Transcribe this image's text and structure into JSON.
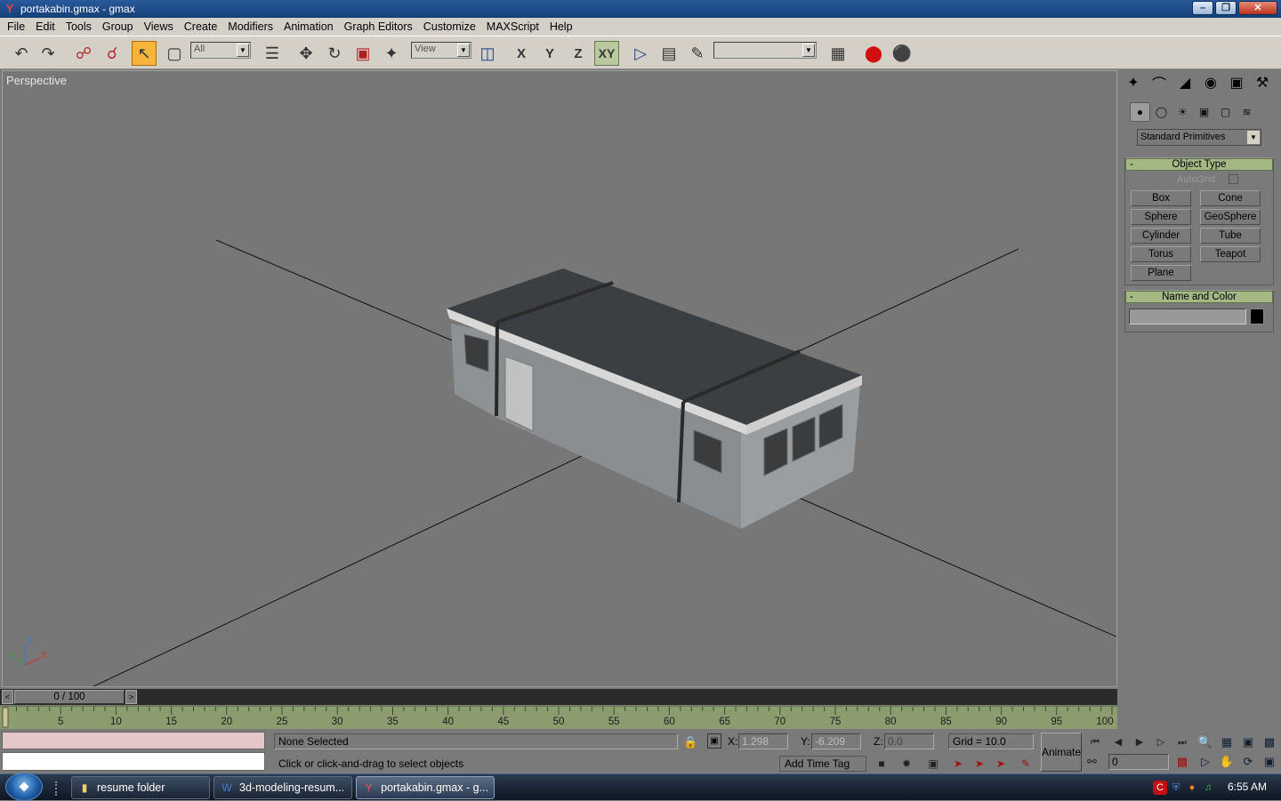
{
  "window": {
    "title": "portakabin.gmax - gmax",
    "app_icon": "gmax-logo-icon",
    "controls": [
      "minimize-icon",
      "restore-icon",
      "close-icon"
    ]
  },
  "menubar": {
    "items": [
      "File",
      "Edit",
      "Tools",
      "Group",
      "Views",
      "Create",
      "Modifiers",
      "Animation",
      "Graph Editors",
      "Customize",
      "MAXScript",
      "Help"
    ]
  },
  "toolbar": {
    "selection_filter": "All",
    "reference_coord": "View",
    "axis_x": "X",
    "axis_y": "Y",
    "axis_z": "Z",
    "axis_xy": "XY",
    "named_selection": "",
    "icons": [
      "undo-icon",
      "redo-icon",
      "select-and-link-icon",
      "unlink-icon",
      "select-object-icon",
      "rectangular-selection-icon",
      "select-by-name-icon",
      "move-icon",
      "rotate-icon",
      "scale-icon",
      "manipulate-icon",
      "pivot-icon",
      "mirror-icon",
      "align-icon",
      "spacing-icon",
      "named-selection-icon",
      "material-editor-icon",
      "render-scene-icon",
      "quick-render-icon"
    ]
  },
  "viewport": {
    "label": "Perspective",
    "axis_tripod": {
      "x": "X",
      "y": "Y",
      "z": "Z"
    }
  },
  "command_panel": {
    "tabs": [
      "create-tab-icon",
      "modify-tab-icon",
      "hierarchy-tab-icon",
      "motion-tab-icon",
      "display-tab-icon",
      "utilities-tab-icon"
    ],
    "subtabs": [
      "geometry-icon",
      "shapes-icon",
      "lights-icon",
      "cameras-icon",
      "helpers-icon",
      "space-warps-icon"
    ],
    "category": "Standard Primitives",
    "object_type": {
      "title": "Object Type",
      "collapse": "-",
      "autogrid": "AutoGrid",
      "buttons": [
        "Box",
        "Cone",
        "Sphere",
        "GeoSphere",
        "Cylinder",
        "Tube",
        "Torus",
        "Teapot",
        "Plane"
      ]
    },
    "name_and_color": {
      "title": "Name and Color",
      "collapse": "-",
      "name_value": "",
      "color": "#000000"
    }
  },
  "time_slider": {
    "label": "0 / 100",
    "left_arrow": "<",
    "right_arrow": ">"
  },
  "trackbar": {
    "labels": [
      "5",
      "10",
      "15",
      "20",
      "25",
      "30",
      "35",
      "40",
      "45",
      "50",
      "55",
      "60",
      "65",
      "70",
      "75",
      "80",
      "85",
      "90",
      "95",
      "100"
    ]
  },
  "status": {
    "selection": "None Selected",
    "prompt": "Click or click-and-drag to select objects",
    "x_label": "X:",
    "x_value": "1.298",
    "y_label": "Y:",
    "y_value": "-6.209",
    "z_label": "Z:",
    "z_value": "0.0",
    "grid": "Grid = 10.0",
    "add_time_tag": "Add Time Tag",
    "animate": "Animate",
    "current_frame": "0"
  },
  "taskbar": {
    "start": "start-orb-icon",
    "tasks": [
      {
        "label": "resume folder",
        "icon": "folder-icon"
      },
      {
        "label": "3d-modeling-resum...",
        "icon": "word-document-icon"
      },
      {
        "label": "portakabin.gmax - g...",
        "icon": "gmax-logo-icon"
      }
    ],
    "tray_icons": [
      "antivirus-icon",
      "shield-icon",
      "network-icon",
      "volume-icon"
    ],
    "clock": "6:55 AM"
  },
  "colors": {
    "viewport_bg": "#777777",
    "rollout_header": "#a4b884",
    "trackbar": "#8c9c6e",
    "active_tool": "#f6b43a",
    "listener_pink": "#e4c7c9"
  }
}
